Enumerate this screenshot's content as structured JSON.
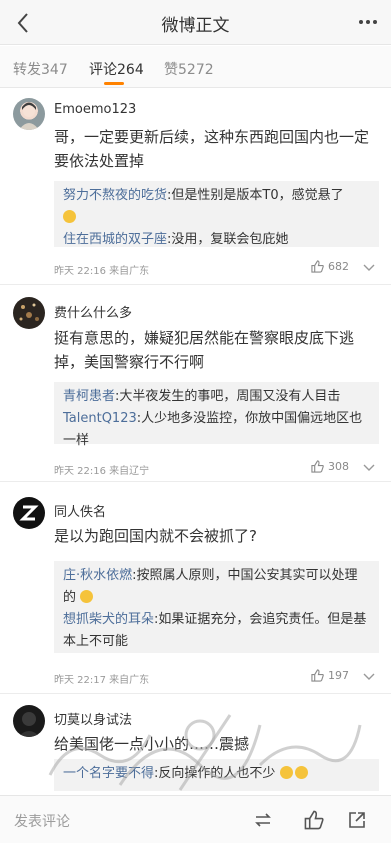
{
  "navbar": {
    "title": "微博正文",
    "back_icon": "chevron-left-icon",
    "more_icon": "ellipsis-icon"
  },
  "tabs": [
    {
      "label": "转发347",
      "active": false
    },
    {
      "label": "评论264",
      "active": true
    },
    {
      "label": "赞5272",
      "active": false
    }
  ],
  "comments": [
    {
      "username": "Emoemo123",
      "text": "哥，一定要更新后续，这种东西跑回国内也一定要依法处置掉",
      "replies": [
        {
          "name": "努力不熬夜的吃货",
          "text": ":但是性别是版本T0，感觉悬了"
        },
        {
          "name": "住在西城的双子座",
          "text": ":没用，复联会包庇她"
        }
      ],
      "meta": "昨天 22:16 来自广东",
      "likes": "682"
    },
    {
      "username": "费什么什么多",
      "text": "挺有意思的，嫌疑犯居然能在警察眼皮底下逃掉，美国警察行不行啊",
      "replies": [
        {
          "name": "青柯患者",
          "text": ":大半夜发生的事吧，周围又没有人目击"
        },
        {
          "name": "TalentQ123",
          "text": ":人少地多没监控，你放中国偏远地区也一样"
        }
      ],
      "meta": "昨天 22:16 来自辽宁",
      "likes": "308"
    },
    {
      "username": "同人佚名",
      "text": "是以为跑回国内就不会被抓了?",
      "replies": [
        {
          "name": "庄·秋水依燃",
          "text": ":按照属人原则，中国公安其实可以处理的"
        },
        {
          "name": "想抓柴犬的耳朵",
          "text": ":如果证据充分，会追究责任。但是基本上不可能"
        }
      ],
      "meta": "昨天 22:17 来自广东",
      "likes": "197"
    },
    {
      "username": "切莫以身试法",
      "text": "给美国佬一点小小的……震撼",
      "replies": [
        {
          "name": "一个名字要不得",
          "text": ":反向操作的人也不少"
        }
      ]
    }
  ],
  "bottombar": {
    "placeholder": "发表评论",
    "icons": [
      "repost-icon",
      "like-icon",
      "share-icon"
    ]
  },
  "colors": {
    "accent": "#ff8200",
    "link": "#4d6e9a",
    "reply_bg": "#f2f2f2"
  }
}
